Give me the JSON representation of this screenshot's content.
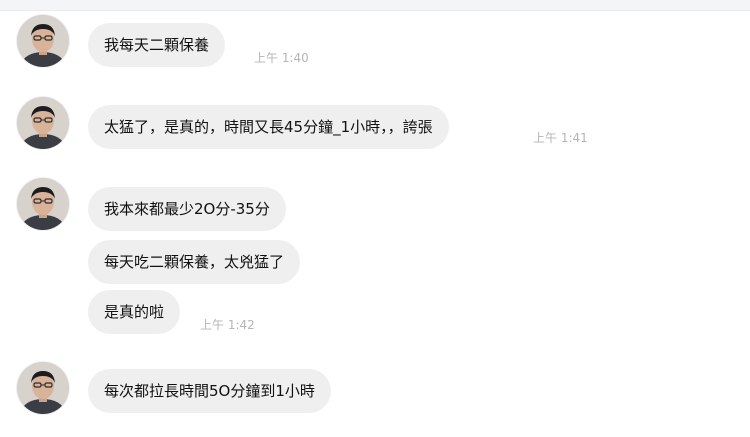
{
  "chat": {
    "messages": [
      {
        "text": "我每天二顆保養",
        "time": "上午 1:40"
      },
      {
        "text": "太猛了，是真的，時間又長45分鐘_1小時，，誇張",
        "time": "上午 1:41"
      },
      {
        "text": "我本來都最少2O分-35分",
        "time": ""
      },
      {
        "text": "每天吃二顆保養，太兇猛了",
        "time": ""
      },
      {
        "text": "是真的啦",
        "time": "上午 1:42"
      },
      {
        "text": "每次都拉長時間5O分鐘到1小時",
        "time": ""
      }
    ]
  },
  "avatar": {
    "icon": "user-avatar-icon"
  }
}
